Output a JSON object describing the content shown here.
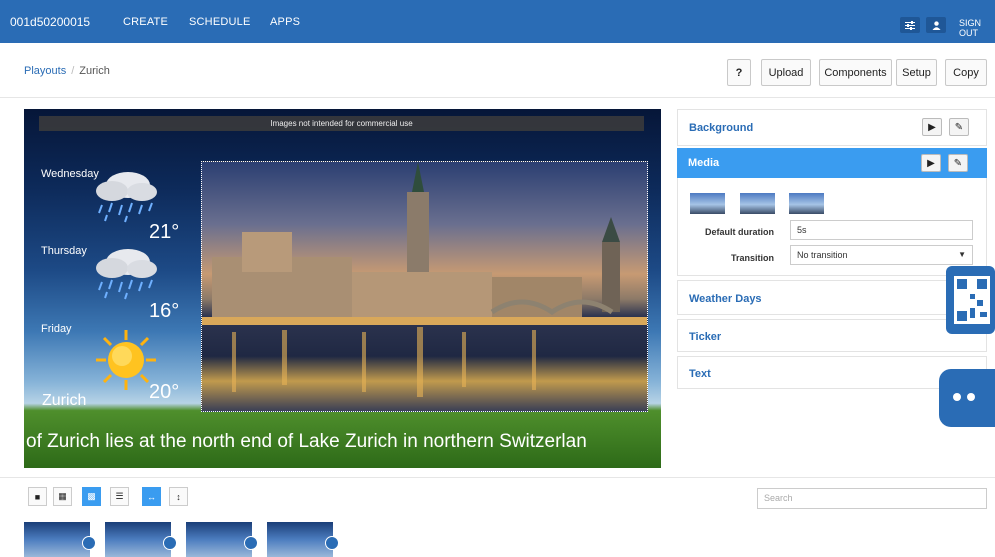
{
  "topbar": {
    "id": "001d50200015",
    "nav": [
      "CREATE",
      "SCHEDULE",
      "APPS"
    ],
    "signout": "SIGN OUT"
  },
  "breadcrumb": {
    "root": "Playouts",
    "separator": "/",
    "current": "Zurich"
  },
  "toolbar": {
    "help": "?",
    "upload": "Upload",
    "components": "Components",
    "setup": "Setup",
    "copy": "Copy"
  },
  "preview": {
    "notice": "Images not intended for commercial use",
    "days": [
      {
        "day": "Wednesday",
        "temp": "21°",
        "icon": "rain-cloud-icon"
      },
      {
        "day": "Thursday",
        "temp": "16°",
        "icon": "rain-cloud-icon"
      },
      {
        "day": "Friday",
        "temp": "20°",
        "icon": "sun-icon"
      }
    ],
    "city": "Zurich",
    "ticker": "of Zurich lies at the north end of Lake Zurich in northern Switzerlan"
  },
  "panels": {
    "background": "Background",
    "media": "Media",
    "default_duration_label": "Default duration",
    "default_duration_value": "5s",
    "transition_label": "Transition",
    "transition_value": "No transition",
    "weather_days": "Weather Days",
    "ticker": "Ticker",
    "text": "Text"
  },
  "bottom": {
    "search_placeholder": "Search"
  },
  "colors": {
    "brand": "#2a6cb5",
    "active": "#3a9cf0"
  }
}
